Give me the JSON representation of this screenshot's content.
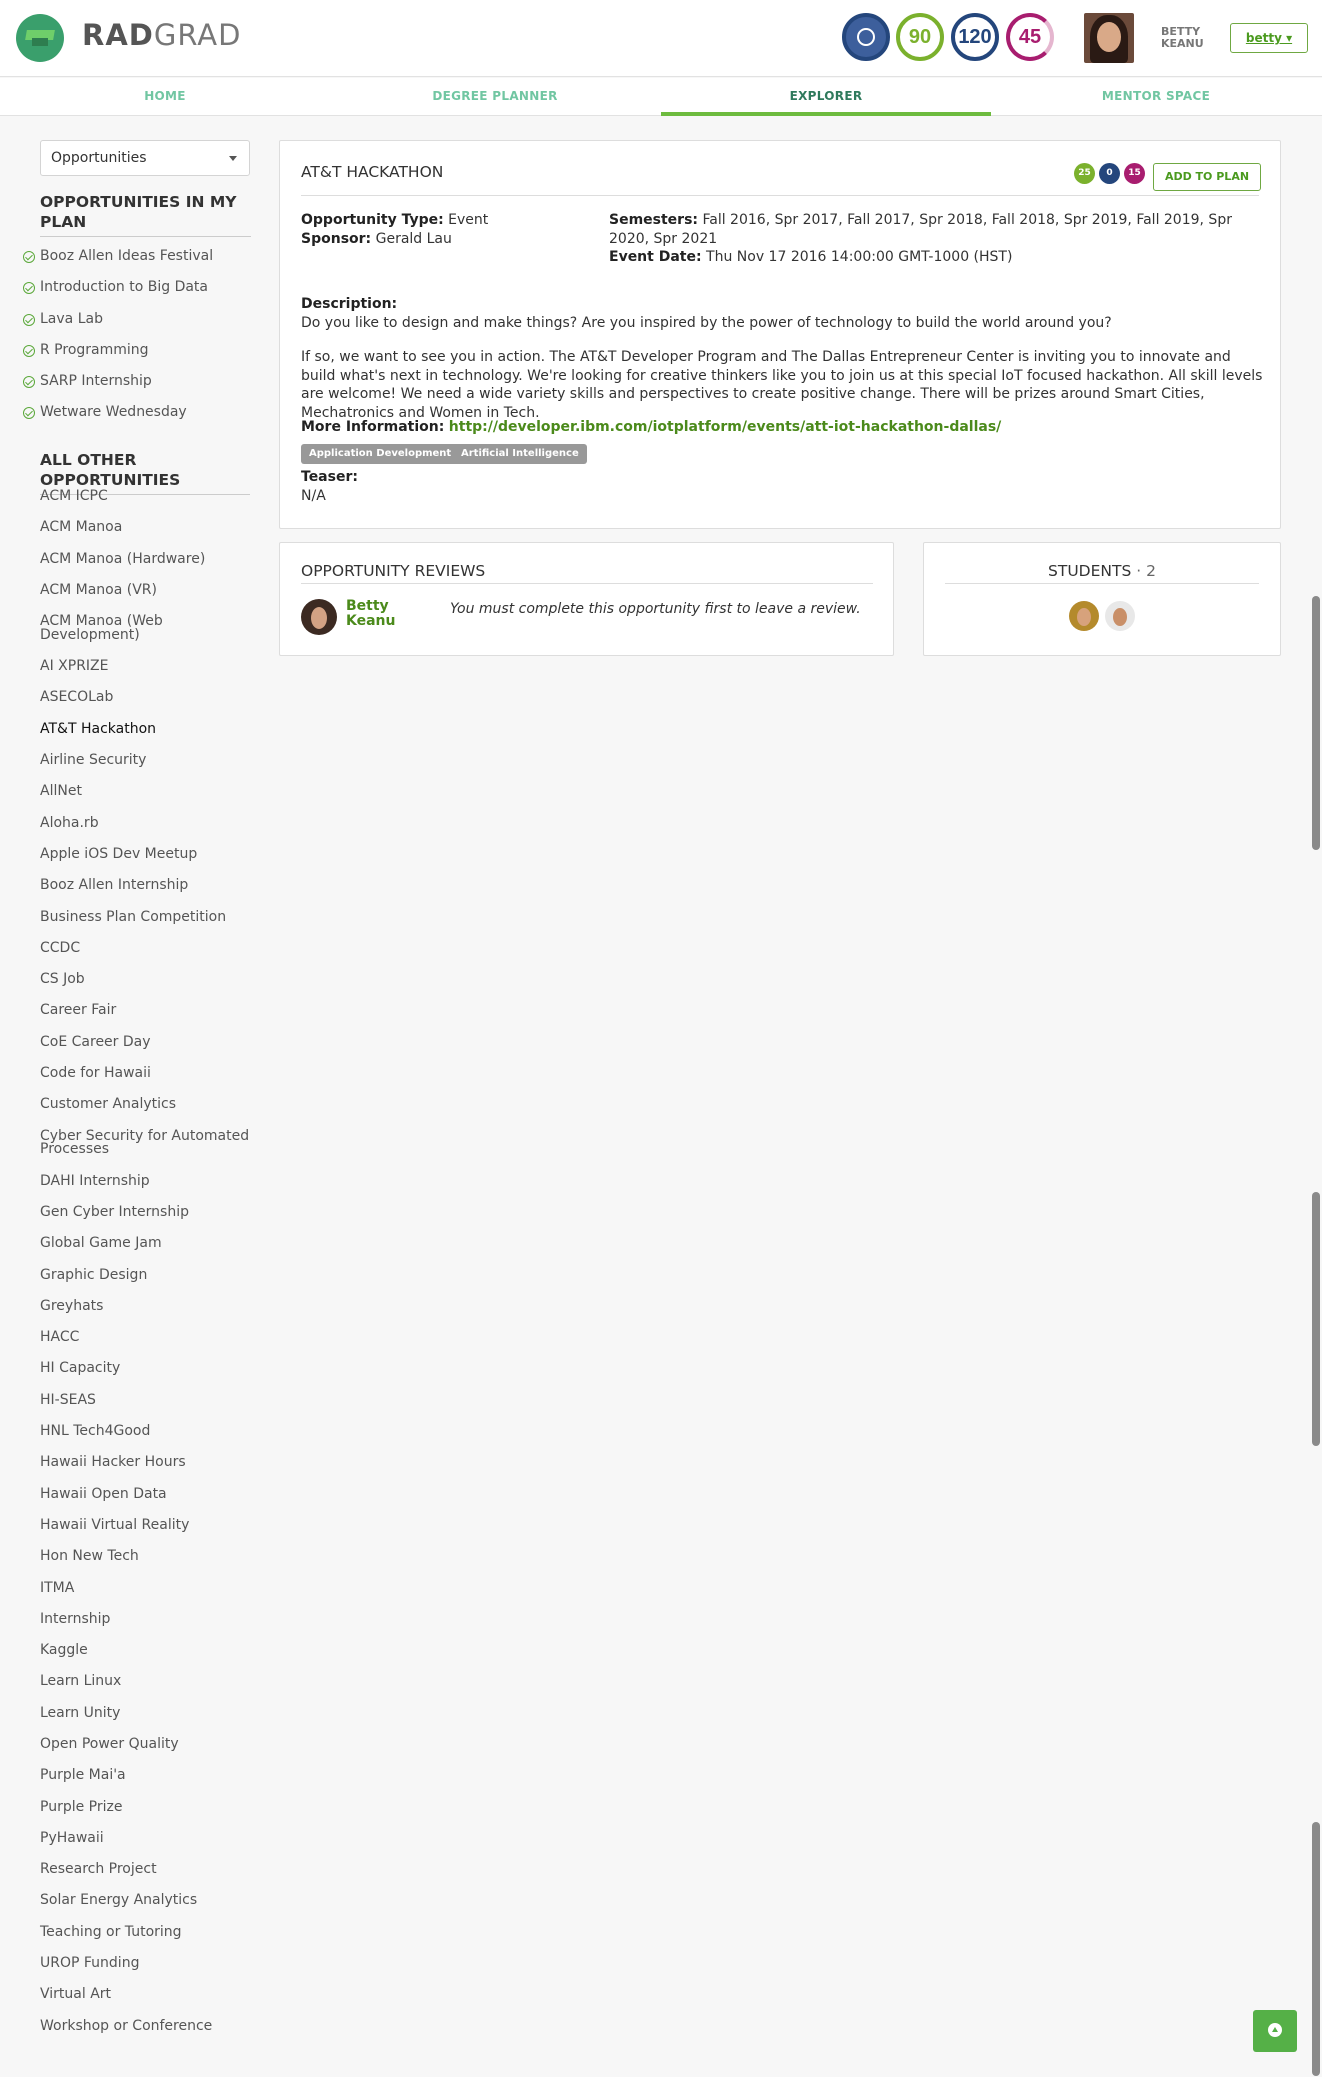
{
  "header": {
    "brand_bold": "RAD",
    "brand_light": "GRAD",
    "ice_innovation": "90",
    "ice_competency": "120",
    "ice_experience": "45",
    "user_first": "BETTY",
    "user_last": "KEANU",
    "user_menu": "betty ▾",
    "colors": {
      "innovation": "#7bb12d",
      "competency": "#24467c",
      "experience": "#a81d6f",
      "accent": "#6dbb3e"
    }
  },
  "nav": {
    "tabs": [
      {
        "label": "HOME"
      },
      {
        "label": "DEGREE PLANNER"
      },
      {
        "label": "EXPLORER"
      },
      {
        "label": "MENTOR SPACE"
      }
    ]
  },
  "sidebar": {
    "dropdown": "Opportunities",
    "plan_heading": "OPPORTUNITIES IN MY PLAN",
    "plan_items": [
      "Booz Allen Ideas Festival",
      "Introduction to Big Data",
      "Lava Lab",
      "R Programming",
      "SARP Internship",
      "Wetware Wednesday"
    ],
    "other_heading": "ALL OTHER OPPORTUNITIES",
    "other_items": [
      "ACM ICPC",
      "ACM Manoa",
      "ACM Manoa (Hardware)",
      "ACM Manoa (VR)",
      "ACM Manoa (Web Development)",
      "AI XPRIZE",
      "ASECOLab",
      "AT&T Hackathon",
      "Airline Security",
      "AllNet",
      "Aloha.rb",
      "Apple iOS Dev Meetup",
      "Booz Allen Internship",
      "Business Plan Competition",
      "CCDC",
      "CS Job",
      "Career Fair",
      "CoE Career Day",
      "Code for Hawaii",
      "Customer Analytics",
      "Cyber Security for Automated Processes",
      "DAHI Internship",
      "Gen Cyber Internship",
      "Global Game Jam",
      "Graphic Design",
      "Greyhats",
      "HACC",
      "HI Capacity",
      "HI-SEAS",
      "HNL Tech4Good",
      "Hawaii Hacker Hours",
      "Hawaii Open Data",
      "Hawaii Virtual Reality",
      "Hon New Tech",
      "ITMA",
      "Internship",
      "Kaggle",
      "Learn Linux",
      "Learn Unity",
      "Open Power Quality",
      "Purple Mai'a",
      "Purple Prize",
      "PyHawaii",
      "Research Project",
      "Solar Energy Analytics",
      "Teaching or Tutoring",
      "UROP Funding",
      "Virtual Art",
      "Workshop or Conference"
    ]
  },
  "opportunity": {
    "title": "AT&T HACKATHON",
    "ice_i": "25",
    "ice_c": "0",
    "ice_e": "15",
    "add_to_plan": "ADD TO PLAN",
    "type_label": "Opportunity Type:",
    "type_value": "Event",
    "sponsor_label": "Sponsor:",
    "sponsor_value": "Gerald Lau",
    "semesters_label": "Semesters:",
    "semesters_value": "Fall 2016, Spr 2017, Fall 2017, Spr 2018, Fall 2018, Spr 2019, Fall 2019, Spr 2020, Spr 2021",
    "event_date_label": "Event Date:",
    "event_date_value": "Thu Nov 17 2016 14:00:00 GMT-1000 (HST)",
    "description_label": "Description:",
    "description_p1": "Do you like to design and make things? Are you inspired by the power of technology to build the world around you?",
    "description_p2": "If so, we want to see you in action. The AT&T Developer Program and The Dallas Entrepreneur Center is inviting you to innovate and build what's next in technology. We're looking for creative thinkers like you to join us at this special IoT focused hackathon. All skill levels are welcome! We need a wide variety skills and perspectives to create positive change. There will be prizes around Smart Cities, Mechatronics and Women in Tech.",
    "more_info_label": "More Information:",
    "more_info_url": "http://developer.ibm.com/iotplatform/events/att-iot-hackathon-dallas/",
    "tags": [
      "Application Development",
      "Artificial Intelligence"
    ],
    "teaser_label": "Teaser:",
    "teaser_value": "N/A"
  },
  "reviews": {
    "heading": "OPPORTUNITY REVIEWS",
    "reviewer": "Betty Keanu",
    "message": "You must complete this opportunity first to leave a review."
  },
  "students": {
    "heading": "STUDENTS",
    "count": "· 2"
  }
}
